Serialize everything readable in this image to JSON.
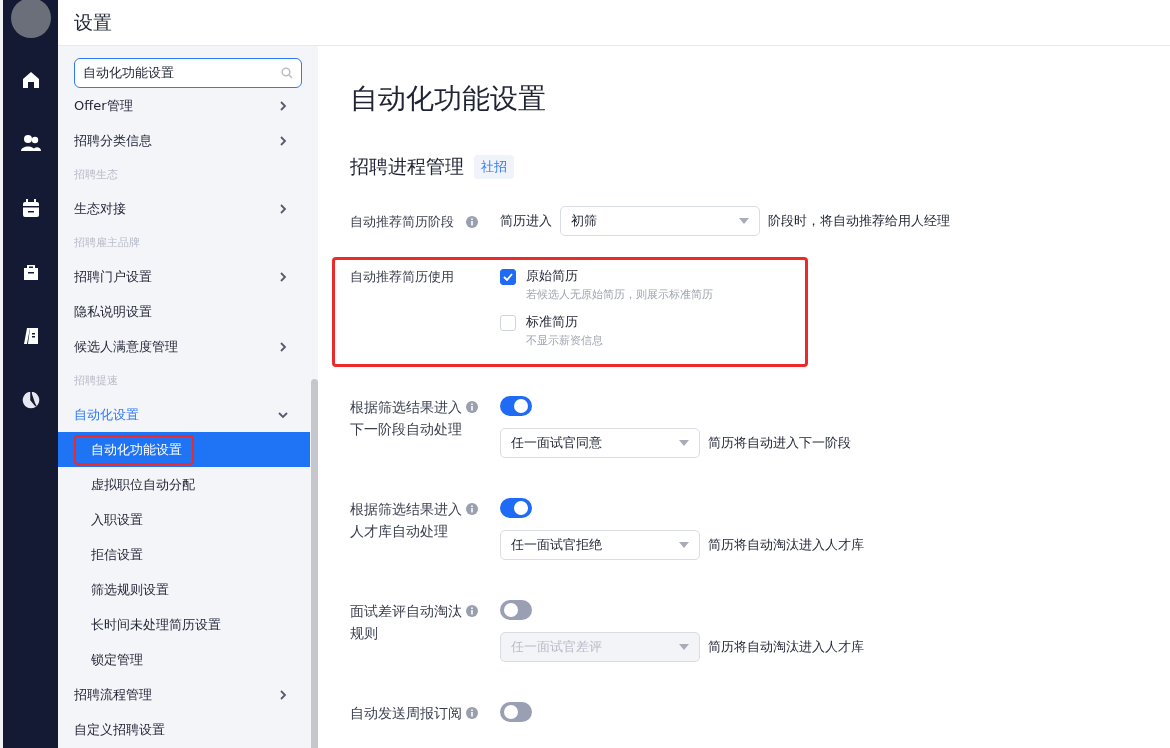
{
  "header": {
    "title": "设置"
  },
  "sidebar": {
    "search": {
      "value": "自动化功能设置"
    },
    "items": [
      {
        "kind": "item",
        "label": "Offer管理",
        "expanded": false
      },
      {
        "kind": "item",
        "label": "招聘分类信息",
        "expanded": false
      },
      {
        "kind": "group",
        "label": "招聘生态"
      },
      {
        "kind": "item",
        "label": "生态对接",
        "expanded": false
      },
      {
        "kind": "group",
        "label": "招聘雇主品牌"
      },
      {
        "kind": "item",
        "label": "招聘门户设置",
        "expanded": false
      },
      {
        "kind": "leaf",
        "label": "隐私说明设置"
      },
      {
        "kind": "item",
        "label": "候选人满意度管理",
        "expanded": false
      },
      {
        "kind": "group",
        "label": "招聘提速"
      },
      {
        "kind": "item",
        "label": "自动化设置",
        "expanded": true,
        "children": [
          {
            "label": "自动化功能设置",
            "selected": true,
            "highlighted": true
          },
          {
            "label": "虚拟职位自动分配",
            "selected": false,
            "highlighted": false
          },
          {
            "label": "入职设置",
            "selected": false,
            "highlighted": false
          },
          {
            "label": "拒信设置",
            "selected": false,
            "highlighted": false
          },
          {
            "label": "筛选规则设置",
            "selected": false,
            "highlighted": false
          },
          {
            "label": "长时间未处理简历设置",
            "selected": false,
            "highlighted": false
          },
          {
            "label": "锁定管理",
            "selected": false,
            "highlighted": false
          }
        ]
      },
      {
        "kind": "item",
        "label": "招聘流程管理",
        "expanded": false
      },
      {
        "kind": "leaf",
        "label": "自定义招聘设置"
      }
    ]
  },
  "page": {
    "title": "自动化功能设置",
    "section": {
      "title": "招聘进程管理",
      "tag": "社招"
    },
    "rows": [
      {
        "kind": "select",
        "label": "自动推荐简历阶段",
        "info": true,
        "prefix": "简历进入",
        "select": {
          "value": "初筛",
          "disabled": false
        },
        "suffix": "阶段时，将自动推荐给用人经理",
        "highlighted": false
      },
      {
        "kind": "checkboxes",
        "label": "自动推荐简历使用",
        "highlighted": true,
        "options": [
          {
            "label": "原始简历",
            "hint": "若候选人无原始简历，则展示标准简历",
            "checked": true
          },
          {
            "label": "标准简历",
            "hint": "不显示薪资信息",
            "checked": false
          }
        ]
      },
      {
        "kind": "toggle",
        "label": "根据筛选结果进入下一阶段自动处理",
        "info": true,
        "on": true,
        "select": {
          "value": "任一面试官同意",
          "disabled": false
        },
        "suffix": "简历将自动进入下一阶段",
        "highlighted": false
      },
      {
        "kind": "toggle",
        "label": "根据筛选结果进入人才库自动处理",
        "info": true,
        "on": true,
        "select": {
          "value": "任一面试官拒绝",
          "disabled": false
        },
        "suffix": "简历将自动淘汰进入人才库",
        "highlighted": false
      },
      {
        "kind": "toggle",
        "label": "面试差评自动淘汰规则",
        "info": true,
        "on": false,
        "select": {
          "value": "任一面试官差评",
          "disabled": true
        },
        "suffix": "简历将自动淘汰进入人才库",
        "highlighted": false
      },
      {
        "kind": "toggle",
        "label": "自动发送周报订阅",
        "info": true,
        "on": false,
        "highlighted": false
      }
    ]
  }
}
